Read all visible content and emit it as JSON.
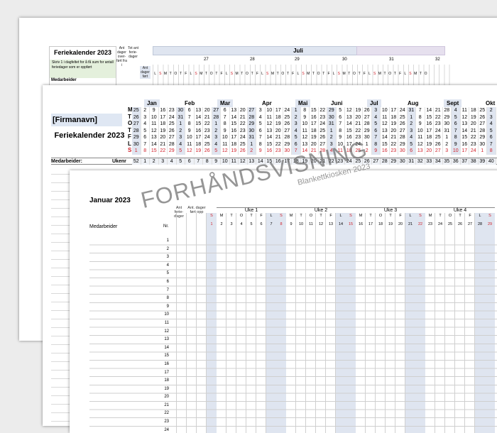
{
  "sheet1": {
    "title": "Feriekalender 2023",
    "note": "Skriv 1 i dagfeltet for å få sum for antall feriedager som er oppført",
    "col_ant_dager": "Ant dager over- ført fra i",
    "col_tot_ant": "Tot ant ferie- dager",
    "col_ant_dager_fort": "Ant dager ført",
    "month": "Juli",
    "weeks": [
      "27",
      "28",
      "29",
      "30",
      "31",
      "32"
    ],
    "day_letters": [
      "L",
      "S",
      "M",
      "T",
      "O",
      "T",
      "F",
      "L",
      "S",
      "M",
      "T",
      "O",
      "T",
      "F",
      "L",
      "S",
      "M",
      "T",
      "O",
      "T",
      "F",
      "L",
      "S",
      "M",
      "T",
      "O",
      "T",
      "F",
      "L",
      "S",
      "M",
      "T",
      "O",
      "T",
      "F",
      "L",
      "S",
      "M",
      "T",
      "O",
      "T",
      "F",
      "L",
      "S",
      "M",
      "T",
      "O",
      "T",
      "F",
      "L",
      "S",
      "M",
      "T",
      "O"
    ],
    "cut_label": "Medarbeider"
  },
  "sheet2": {
    "company": "[Firmanavn]",
    "title": "Feriekalender 2023",
    "weekday_letters": [
      "M",
      "T",
      "O",
      "T",
      "F",
      "L",
      "S"
    ],
    "months": [
      "Jan",
      "Feb",
      "Mar",
      "Apr",
      "Mai",
      "Juni",
      "Jul",
      "Aug",
      "Sept",
      "Okt"
    ],
    "calendar_rows": [
      [
        "25",
        "2",
        "9",
        "16",
        "23",
        "30",
        "6",
        "13",
        "20",
        "27",
        "6",
        "13",
        "20",
        "27",
        "3",
        "10",
        "17",
        "24",
        "1",
        "8",
        "15",
        "22",
        "29",
        "5",
        "12",
        "19",
        "26",
        "3",
        "10",
        "17",
        "24",
        "31",
        "7",
        "14",
        "21",
        "28",
        "4",
        "11",
        "18",
        "25",
        "2"
      ],
      [
        "26",
        "3",
        "10",
        "17",
        "24",
        "31",
        "7",
        "14",
        "21",
        "28",
        "7",
        "14",
        "21",
        "28",
        "4",
        "11",
        "18",
        "25",
        "2",
        "9",
        "16",
        "23",
        "30",
        "6",
        "13",
        "20",
        "27",
        "4",
        "11",
        "18",
        "25",
        "1",
        "8",
        "15",
        "22",
        "29",
        "5",
        "12",
        "19",
        "26",
        "3"
      ],
      [
        "27",
        "4",
        "11",
        "18",
        "25",
        "1",
        "8",
        "15",
        "22",
        "1",
        "8",
        "15",
        "22",
        "29",
        "5",
        "12",
        "19",
        "26",
        "3",
        "10",
        "17",
        "24",
        "31",
        "7",
        "14",
        "21",
        "28",
        "5",
        "12",
        "19",
        "26",
        "2",
        "9",
        "16",
        "23",
        "30",
        "6",
        "13",
        "20",
        "27",
        "4"
      ],
      [
        "28",
        "5",
        "12",
        "19",
        "26",
        "2",
        "9",
        "16",
        "23",
        "2",
        "9",
        "16",
        "23",
        "30",
        "6",
        "13",
        "20",
        "27",
        "4",
        "11",
        "18",
        "25",
        "1",
        "8",
        "15",
        "22",
        "29",
        "6",
        "13",
        "20",
        "27",
        "3",
        "10",
        "17",
        "24",
        "31",
        "7",
        "14",
        "21",
        "28",
        "5"
      ],
      [
        "29",
        "6",
        "13",
        "20",
        "27",
        "3",
        "10",
        "17",
        "24",
        "3",
        "10",
        "17",
        "24",
        "31",
        "7",
        "14",
        "21",
        "28",
        "5",
        "12",
        "19",
        "26",
        "2",
        "9",
        "16",
        "23",
        "30",
        "7",
        "14",
        "21",
        "28",
        "4",
        "11",
        "18",
        "25",
        "1",
        "8",
        "15",
        "22",
        "29",
        "6"
      ],
      [
        "30",
        "7",
        "14",
        "21",
        "28",
        "4",
        "11",
        "18",
        "25",
        "4",
        "11",
        "18",
        "25",
        "1",
        "8",
        "15",
        "22",
        "29",
        "6",
        "13",
        "20",
        "27",
        "3",
        "10",
        "17",
        "24",
        "1",
        "8",
        "15",
        "22",
        "29",
        "5",
        "12",
        "19",
        "26",
        "2",
        "9",
        "16",
        "23",
        "30",
        "7"
      ],
      [
        "1",
        "8",
        "15",
        "22",
        "29",
        "5",
        "12",
        "19",
        "26",
        "5",
        "12",
        "19",
        "26",
        "2",
        "9",
        "16",
        "23",
        "30",
        "7",
        "14",
        "21",
        "28",
        "4",
        "11",
        "18",
        "25",
        "2",
        "9",
        "16",
        "23",
        "30",
        "6",
        "13",
        "20",
        "27",
        "3",
        "10",
        "17",
        "24",
        "1",
        "8"
      ]
    ],
    "medarbeider_label": "Medarbeider:",
    "ukenr_label": "Ukenr",
    "week_numbers": [
      "52",
      "1",
      "2",
      "3",
      "4",
      "5",
      "6",
      "7",
      "8",
      "9",
      "10",
      "11",
      "12",
      "13",
      "14",
      "15",
      "16",
      "17",
      "18",
      "19",
      "20",
      "21",
      "22",
      "23",
      "24",
      "25",
      "26",
      "27",
      "28",
      "29",
      "30",
      "31",
      "32",
      "33",
      "34",
      "35",
      "36",
      "37",
      "38",
      "39",
      "40"
    ]
  },
  "sheet3": {
    "title": "Januar 2023",
    "medarbeider_label": "Medarbeider",
    "nr_label": "Nr.",
    "col_ant_feriedager": "Ant ferie- dager",
    "col_ant_dager_fort": "Ant. dager ført opp",
    "weeks": [
      {
        "label": "Uke 1",
        "days": [
          "2",
          "3",
          "4",
          "5",
          "6",
          "7",
          "8"
        ]
      },
      {
        "label": "Uke 2",
        "days": [
          "9",
          "10",
          "11",
          "12",
          "13",
          "14",
          "15"
        ]
      },
      {
        "label": "Uke 3",
        "days": [
          "16",
          "17",
          "18",
          "19",
          "20",
          "21",
          "22"
        ]
      },
      {
        "label": "Uke 4",
        "days": [
          "23",
          "24",
          "25",
          "26",
          "27",
          "28",
          "29"
        ]
      }
    ],
    "sunday_before": "1",
    "weekday_letters": [
      "M",
      "T",
      "O",
      "T",
      "F",
      "L",
      "S"
    ],
    "row_numbers": [
      "1",
      "2",
      "3",
      "4",
      "5",
      "6",
      "7",
      "8",
      "9",
      "10",
      "11",
      "12",
      "13",
      "14",
      "15",
      "16",
      "17",
      "18",
      "19",
      "20",
      "21",
      "22",
      "23",
      "24"
    ]
  },
  "watermark": {
    "main": "FORHÅNDSVISNING",
    "sub": "Blankettkiosken 2023"
  },
  "colors": {
    "header_blue": "#dfe5f0",
    "weekend_red": "#d0202a",
    "note_green": "#e4f0dc"
  }
}
